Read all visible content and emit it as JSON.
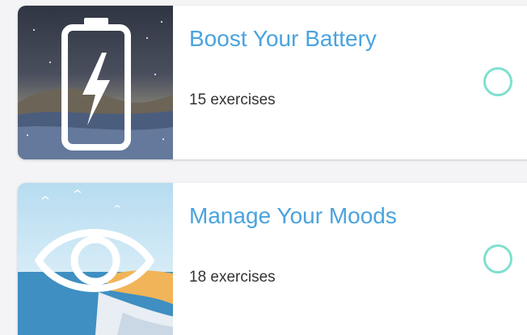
{
  "programs": [
    {
      "title": "Boost Your Battery",
      "count": "15 exercises",
      "icon": "battery-bolt-icon",
      "completed": false
    },
    {
      "title": "Manage Your Moods",
      "count": "18 exercises",
      "icon": "eye-icon",
      "completed": false
    }
  ],
  "colors": {
    "title": "#4aa3df",
    "check_ring": "#7fe0cf",
    "count": "#333333"
  }
}
